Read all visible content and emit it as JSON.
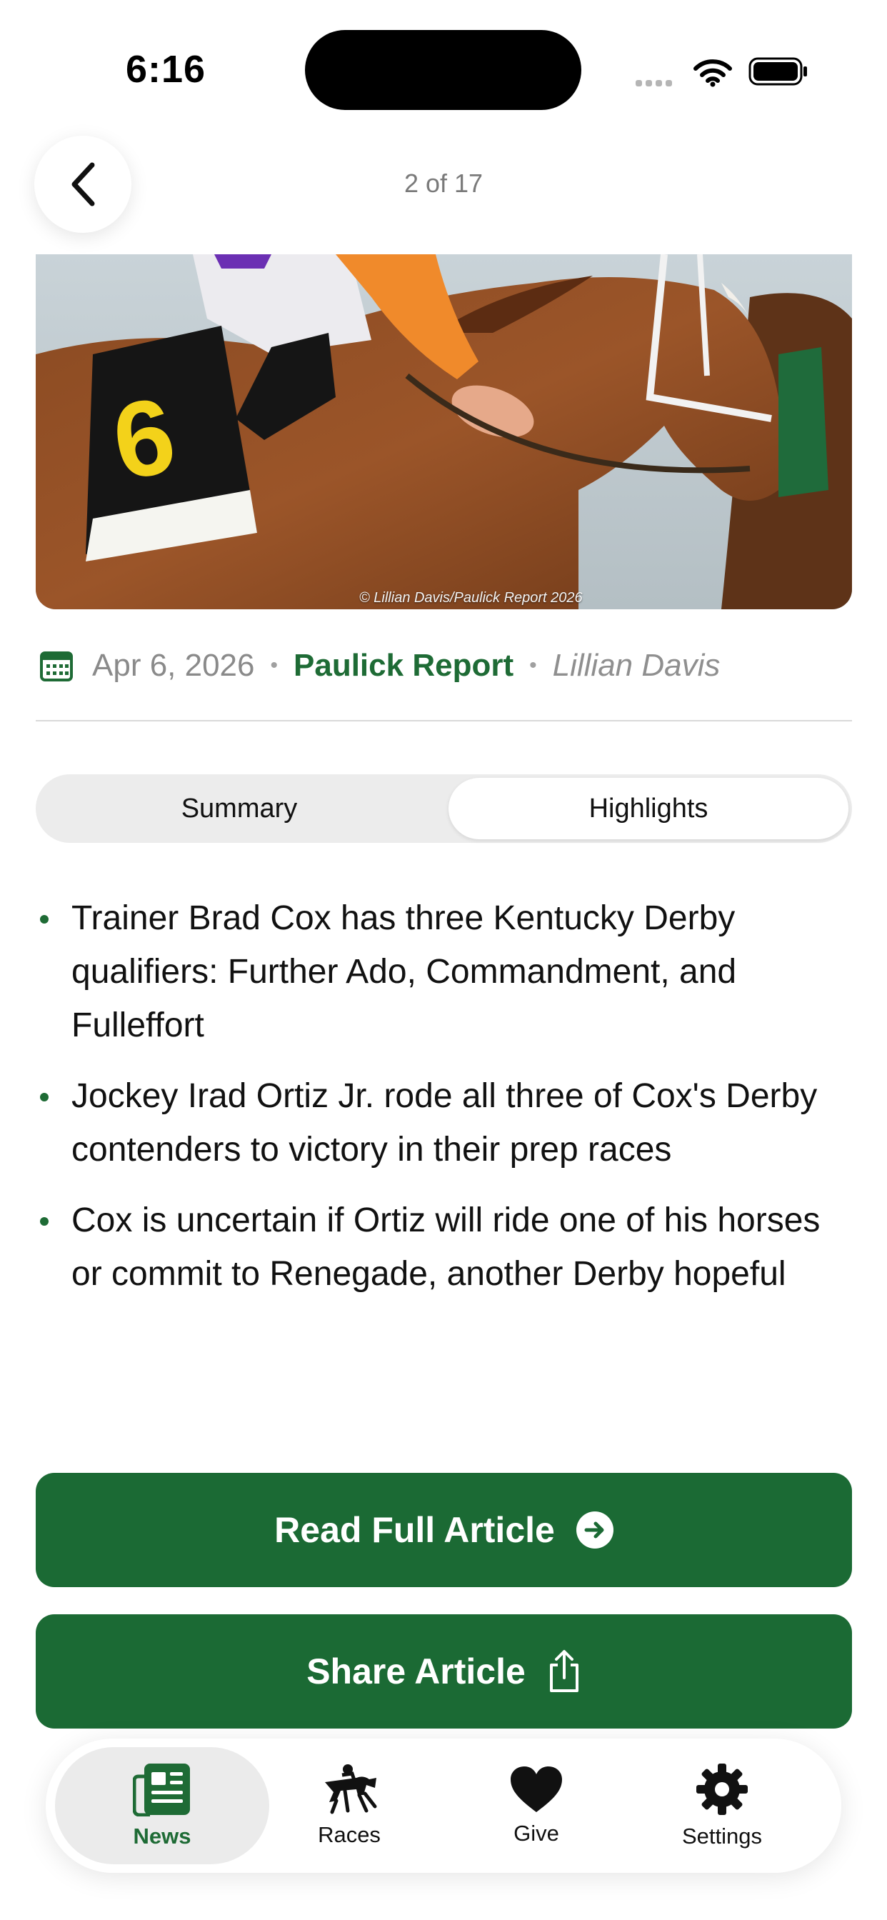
{
  "status_bar": {
    "time": "6:16"
  },
  "nav": {
    "counter": "2 of 17"
  },
  "hero": {
    "credit": "© Lillian Davis/Paulick Report 2026"
  },
  "meta": {
    "date": "Apr 6, 2026",
    "source": "Paulick Report",
    "author": "Lillian Davis"
  },
  "segmented": {
    "summary": "Summary",
    "highlights": "Highlights",
    "selected": "Highlights"
  },
  "highlights": [
    "Trainer Brad Cox has three Kentucky Derby qualifiers: Further Ado, Commandment, and Fulleffort",
    "Jockey Irad Ortiz Jr. rode all three of Cox's Derby contenders to victory in their prep races",
    "Cox is uncertain if Ortiz will ride one of his horses or commit to Renegade, another Derby hopeful"
  ],
  "buttons": {
    "read": "Read Full Article",
    "share": "Share Article"
  },
  "tabs": [
    {
      "label": "News",
      "icon": "newspaper-icon",
      "active": true
    },
    {
      "label": "Races",
      "icon": "horse-racing-icon",
      "active": false
    },
    {
      "label": "Give",
      "icon": "heart-icon",
      "active": false
    },
    {
      "label": "Settings",
      "icon": "gear-icon",
      "active": false
    }
  ],
  "colors": {
    "accent": "#1e6b35",
    "button": "#1b6a34"
  }
}
